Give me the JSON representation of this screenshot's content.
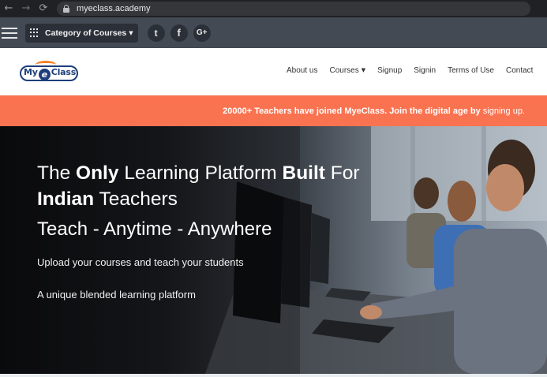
{
  "browser": {
    "back_icon": "←",
    "forward_icon": "→",
    "reload_icon": "⟳",
    "url": "myeclass.academy"
  },
  "toolbar": {
    "category_label": "Category of Courses",
    "social": [
      "twitter",
      "facebook",
      "google-plus"
    ],
    "twitter_glyph": "t",
    "facebook_glyph": "f",
    "googleplus_glyph": "G+"
  },
  "logo": {
    "part1": "My",
    "part2": "e",
    "part3": "Class"
  },
  "nav": {
    "about": "About us",
    "courses": "Courses",
    "signup": "Signup",
    "signin": "Signin",
    "terms": "Terms of Use",
    "contact": "Contact"
  },
  "announcement": {
    "text": "20000+ Teachers have joined MyeClass. Join the digital age by",
    "link": "signing up."
  },
  "hero": {
    "line1_a": "The",
    "line1_b": "Only",
    "line1_c": "Learning Platform",
    "line1_d": "Built",
    "line1_e": "For",
    "line2_a": "Indian",
    "line2_b": "Teachers",
    "line3": "Teach - Anytime - Anywhere",
    "sub1": "Upload your courses and teach your students",
    "sub2": "A unique blended learning platform"
  },
  "colors": {
    "toolbar": "#434a54",
    "announcement": "#fa7351",
    "brand": "#1d3f7a",
    "brand_accent": "#f58025"
  }
}
